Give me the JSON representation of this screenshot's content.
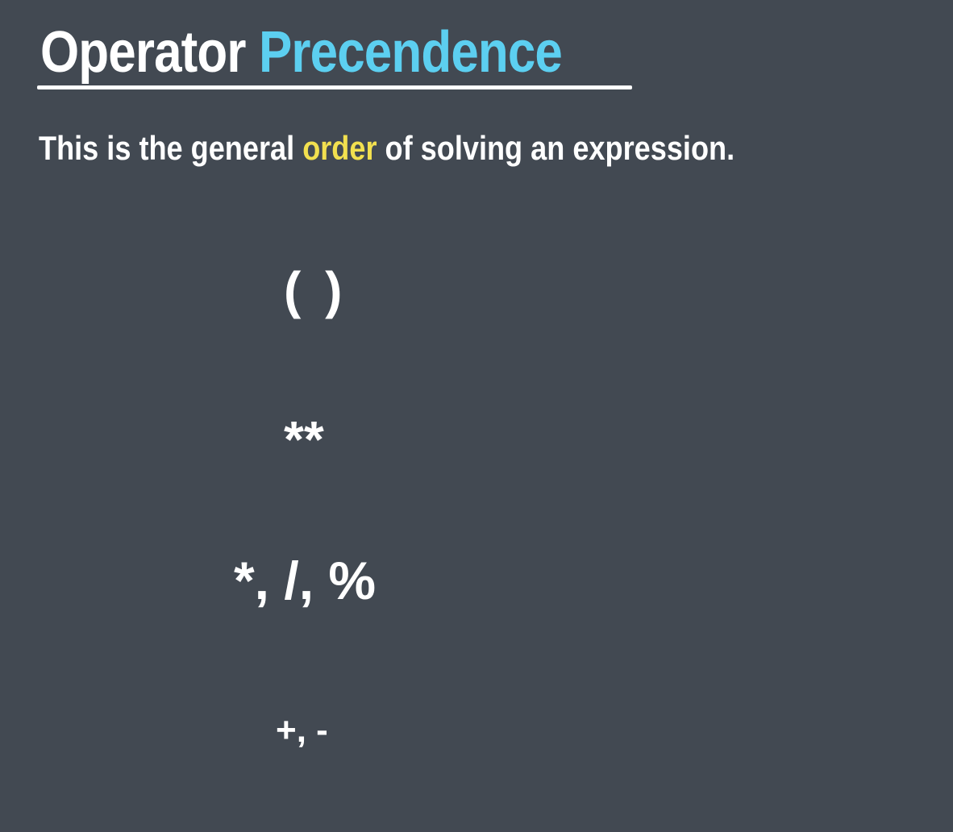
{
  "title": {
    "word1": "Operator",
    "word2": "Precendence"
  },
  "subtitle": {
    "before": "This is the general ",
    "highlight": "order",
    "after": " of solving an expression."
  },
  "precedence_levels": [
    "( )",
    "**",
    "*, /, %",
    "+, -"
  ],
  "colors": {
    "background": "#424952",
    "text": "#ffffff",
    "title_accent": "#5ccff0",
    "highlight": "#f2e04f"
  }
}
